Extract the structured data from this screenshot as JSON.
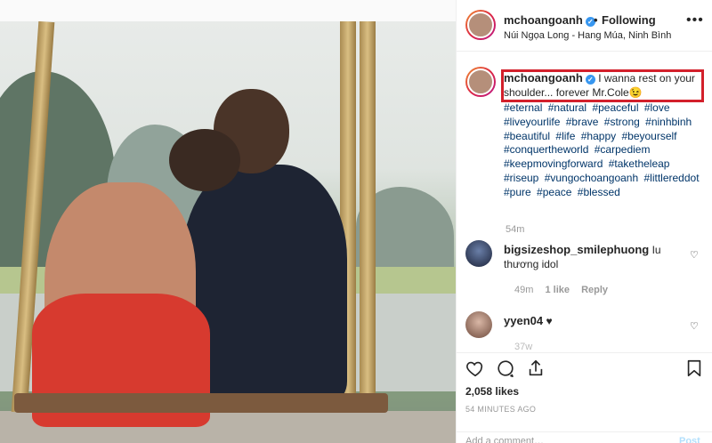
{
  "header": {
    "username": "mchoangoanh",
    "separator": "•",
    "follow_status": "Following",
    "location": "Núi Ngọa Long - Hang Múa, Ninh Bình",
    "more_icon": "more-horizontal-icon"
  },
  "caption": {
    "username": "mchoangoanh",
    "text": "I wanna rest on your shoulder... forever Mr.Cole😉",
    "hashtags": [
      "#eternal",
      "#natural",
      "#peaceful",
      "#love",
      "#liveyourlife",
      "#brave",
      "#strong",
      "#ninhbinh",
      "#beautiful",
      "#life",
      "#happy",
      "#beyourself",
      "#conquertheworld",
      "#carpediem",
      "#keepmovingforward",
      "#taketheleap",
      "#riseup",
      "#vungochoangoanh",
      "#littlereddot",
      "#pure",
      "#peace",
      "#blessed"
    ],
    "time": "54m",
    "highlight_color": "#d3202b"
  },
  "comments": [
    {
      "username": "bigsizeshop_smilephuong",
      "text": "Iu thương idol",
      "time": "49m",
      "likes": "1 like",
      "reply": "Reply"
    },
    {
      "username": "yyen04",
      "text": "♥",
      "time": "37w"
    }
  ],
  "actions": {
    "likes": "2,058 likes",
    "time_ago": "54 MINUTES AGO",
    "add_comment_placeholder": "Add a comment…",
    "post_label": "Post"
  },
  "colors": {
    "link": "#003569",
    "verified": "#3897f0",
    "meta": "#999999"
  }
}
